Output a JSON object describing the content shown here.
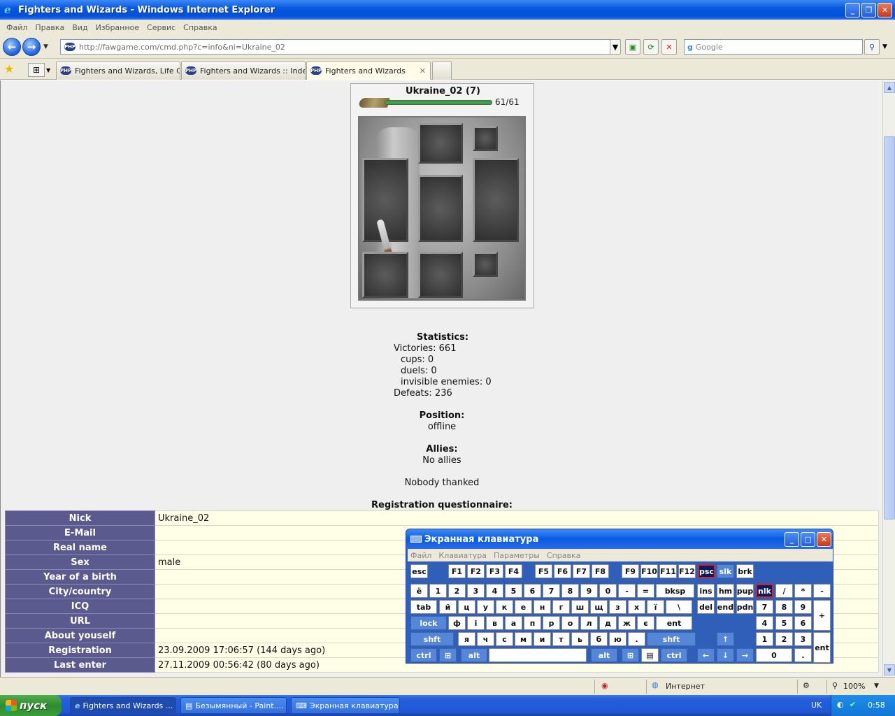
{
  "window": {
    "title": "Fighters and Wizards - Windows Internet Explorer"
  },
  "menu": [
    "Файл",
    "Правка",
    "Вид",
    "Избранное",
    "Сервис",
    "Справка"
  ],
  "address": {
    "url": "http://fawgame.com/cmd.php?c=info&ni=Ukraine_02",
    "search_placeholder": "Google"
  },
  "tabs": [
    {
      "label": "Fighters and Wizards, Life City"
    },
    {
      "label": "Fighters and Wizards :: Index"
    },
    {
      "label": "Fighters and Wizards"
    }
  ],
  "profile": {
    "title": "Ukraine_02 (7)",
    "hp": "61/61"
  },
  "stats": {
    "heading": "Statistics:",
    "victories": "Victories: 661",
    "cups": "cups: 0",
    "duels": "duels: 0",
    "invisible": "invisible enemies: 0",
    "defeats": "Defeats: 236",
    "position_heading": "Position:",
    "position": "offline",
    "allies_heading": "Allies:",
    "allies": "No allies",
    "thanked": "Nobody thanked",
    "reg_heading": "Registration questionnaire:"
  },
  "registration": [
    {
      "label": "Nick",
      "value": "Ukraine_02"
    },
    {
      "label": "E-Mail",
      "value": ""
    },
    {
      "label": "Real name",
      "value": ""
    },
    {
      "label": "Sex",
      "value": "male"
    },
    {
      "label": "Year of a birth",
      "value": ""
    },
    {
      "label": "City/country",
      "value": ""
    },
    {
      "label": "ICQ",
      "value": ""
    },
    {
      "label": "URL",
      "value": ""
    },
    {
      "label": "About youself",
      "value": ""
    },
    {
      "label": "Registration",
      "value": "23.09.2009 17:06:57 (144 days ago)"
    },
    {
      "label": "Last enter",
      "value": "27.11.2009 00:56:42 (80 days ago)"
    }
  ],
  "osk": {
    "title": "Экранная клавиатура",
    "menu": [
      "Файл",
      "Клавиатура",
      "Параметры",
      "Справка"
    ],
    "row1": [
      "esc",
      "F1",
      "F2",
      "F3",
      "F4",
      "F5",
      "F6",
      "F7",
      "F8",
      "F9",
      "F10",
      "F11",
      "F12",
      "psc",
      "slk",
      "brk"
    ],
    "row2": [
      "ё",
      "1",
      "2",
      "3",
      "4",
      "5",
      "6",
      "7",
      "8",
      "9",
      "0",
      "-",
      "=",
      "bksp",
      "ins",
      "hm",
      "pup",
      "nlk",
      "/",
      "*",
      "-"
    ],
    "row3": [
      "tab",
      "й",
      "ц",
      "у",
      "к",
      "е",
      "н",
      "г",
      "ш",
      "щ",
      "з",
      "х",
      "ї",
      "\\",
      "del",
      "end",
      "pdn",
      "7",
      "8",
      "9",
      "+"
    ],
    "row4": [
      "lock",
      "ф",
      "і",
      "в",
      "а",
      "п",
      "р",
      "о",
      "л",
      "д",
      "ж",
      "є",
      "ent",
      "4",
      "5",
      "6"
    ],
    "row5": [
      "shft",
      "я",
      "ч",
      "с",
      "м",
      "и",
      "т",
      "ь",
      "б",
      "ю",
      ".",
      "shft",
      "1",
      "2",
      "3",
      "ent"
    ],
    "row6": [
      "ctrl",
      "alt",
      "alt",
      "ctrl",
      "0",
      "."
    ]
  },
  "status": {
    "zone": "Интернет",
    "zoom": "100%"
  },
  "taskbar": {
    "start": "пуск",
    "items": [
      "Fighters and Wizards ...",
      "Безымянный - Paint....",
      "Экранная клавиатура"
    ],
    "lang": "UK",
    "time": "0:58"
  }
}
